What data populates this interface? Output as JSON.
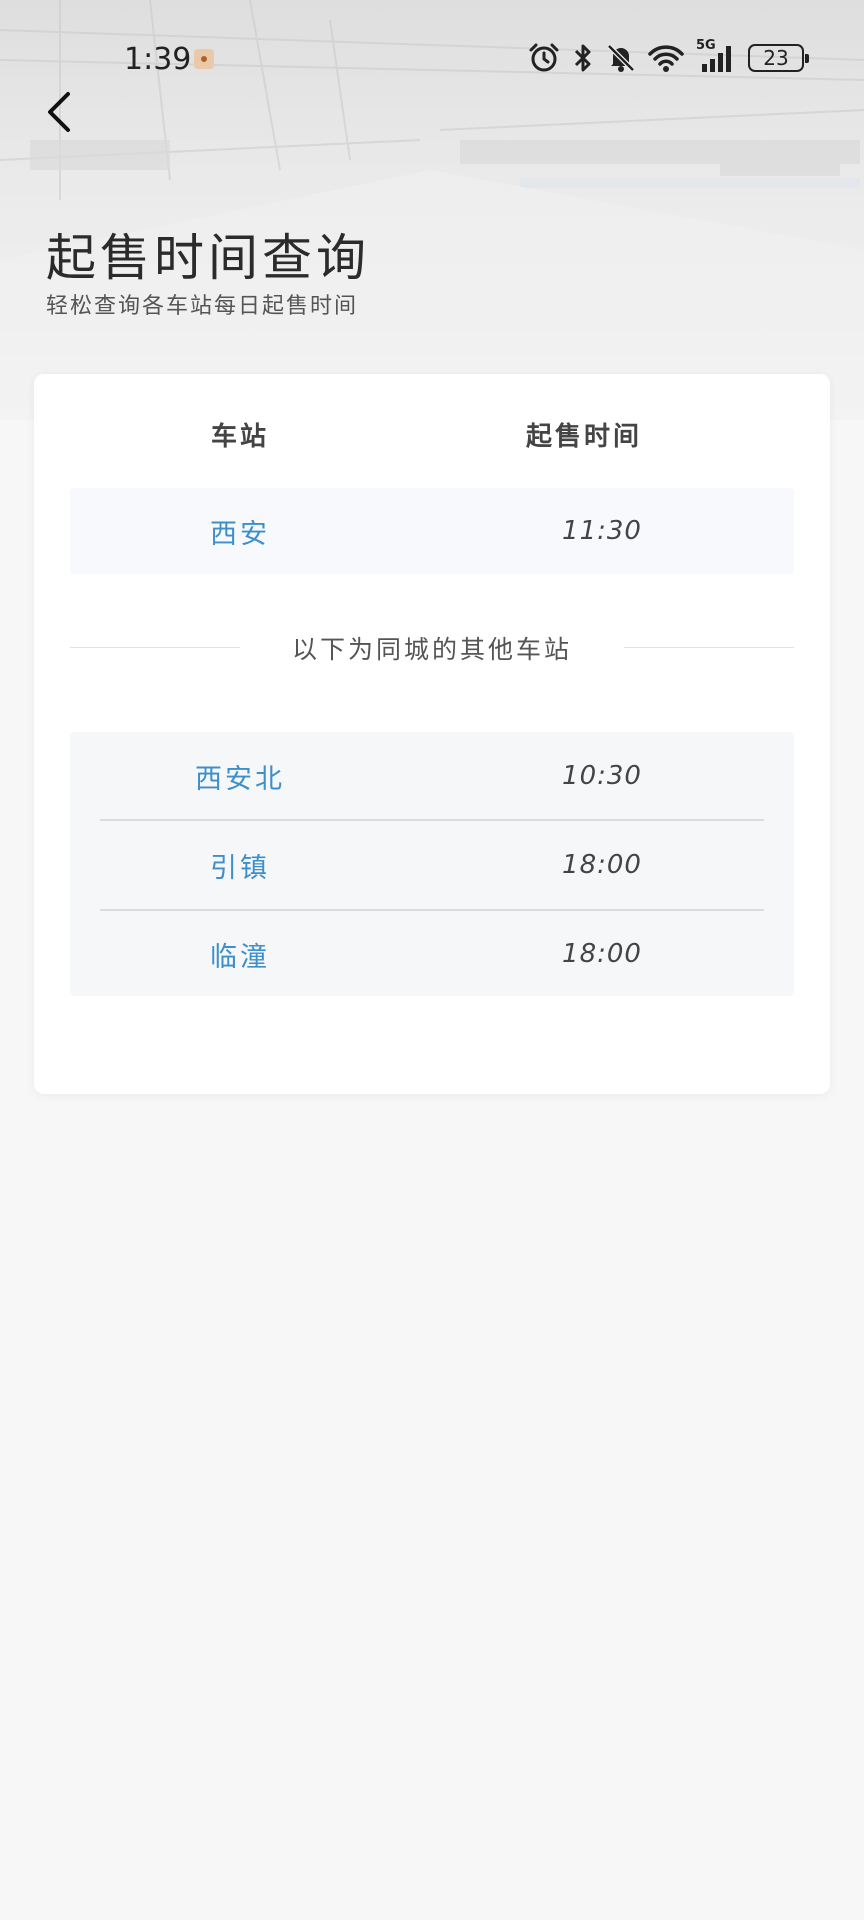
{
  "status_bar": {
    "time": "1:39",
    "battery": "23",
    "signal_label": "5G",
    "icons": [
      "alarm-icon",
      "bluetooth-icon",
      "mute-icon",
      "wifi-icon",
      "signal-icon",
      "battery-icon"
    ]
  },
  "header": {
    "back_icon": "chevron-left-icon",
    "title": "起售时间查询",
    "subtitle": "轻松查询各车站每日起售时间"
  },
  "table": {
    "columns": [
      "车站",
      "起售时间"
    ],
    "primary": {
      "station": "西安",
      "time": "11:30"
    },
    "divider_text": "以下为同城的其他车站",
    "others": [
      {
        "station": "西安北",
        "time": "10:30"
      },
      {
        "station": "引镇",
        "time": "18:00"
      },
      {
        "station": "临潼",
        "time": "18:00"
      }
    ]
  },
  "colors": {
    "accent": "#3d8fcc",
    "background": "#f7f7f7",
    "card": "#ffffff"
  }
}
